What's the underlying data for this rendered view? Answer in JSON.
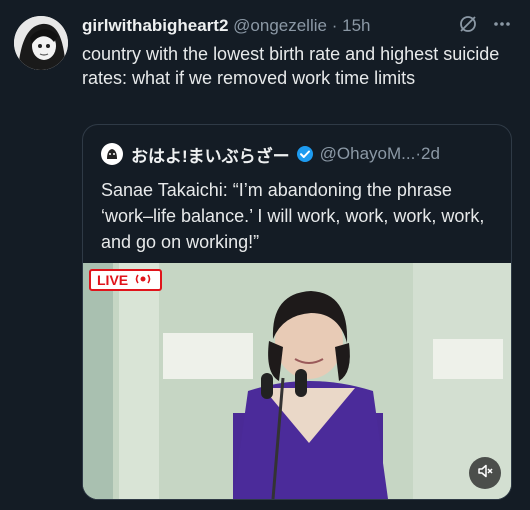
{
  "tweet": {
    "display_name": "girlwithabigheart2",
    "handle": "@ongezellie",
    "separator": "·",
    "time": "15h",
    "text": "country with the lowest birth rate and highest suicide rates: what if we removed work time limits"
  },
  "quote": {
    "display_name": "おはよ!まいぶらざー",
    "handle": "@OhayoM...",
    "separator": "·",
    "time": "2d",
    "text": "Sanae Takaichi: “I’m abandoning the phrase ‘work–life balance.’ I will work, work, work, work, and go on working!”"
  },
  "video": {
    "live_label": "LIVE",
    "muted": true
  },
  "icons": [
    "grok-icon",
    "more-icon",
    "verified-badge-icon",
    "mute-icon",
    "live-signal-icon"
  ],
  "colors": {
    "background": "#141c25",
    "secondary_text": "#8b98a5",
    "verified": "#1d9bf0",
    "live_red": "#e0141b"
  }
}
